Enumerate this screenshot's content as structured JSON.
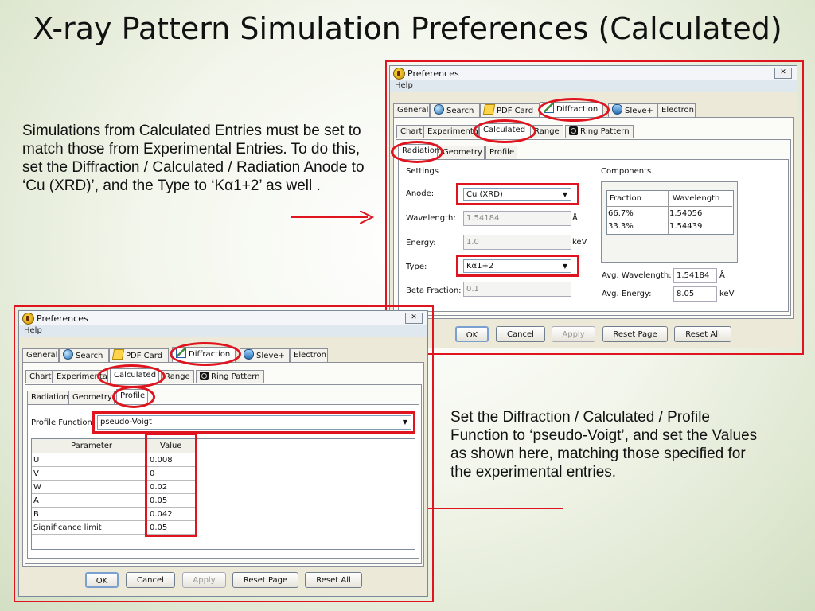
{
  "slide": {
    "title": "X-ray Pattern Simulation Preferences (Calculated)",
    "caption_left": "Simulations from Calculated Entries must be set to match those from Experimental Entries.  To do this, set the Diffraction / Calculated / Radiation  Anode to ‘Cu (XRD)’, and the Type to ‘Kα1+2’ as well .",
    "caption_right": "Set the Diffraction / Calculated / Profile Function to ‘pseudo-Voigt’, and set the Values as shown here, matching those specified for the experimental entries."
  },
  "window": {
    "title": "Preferences",
    "menu": "Help",
    "close": "✕",
    "main_tabs": [
      "General",
      "Search",
      "PDF Card",
      "Diffraction",
      "SIeve+",
      "Electron"
    ],
    "sub_tabs": [
      "Chart",
      "Experimental",
      "Calculated",
      "Range",
      "Ring Pattern"
    ],
    "calc_tabs": [
      "Radiation",
      "Geometry",
      "Profile"
    ],
    "buttons": {
      "ok": "OK",
      "cancel": "Cancel",
      "apply": "Apply",
      "reset_page": "Reset Page",
      "reset_all": "Reset All"
    }
  },
  "radiation": {
    "settings_label": "Settings",
    "components_label": "Components",
    "anode_label": "Anode:",
    "anode_value": "Cu (XRD)",
    "wavelength_label": "Wavelength:",
    "wavelength_value": "1.54184",
    "wavelength_unit": "Å",
    "energy_label": "Energy:",
    "energy_value": "1.0",
    "energy_unit": "keV",
    "type_label": "Type:",
    "type_value": "Kα1+2",
    "beta_label": "Beta Fraction:",
    "beta_value": "0.1",
    "components_headers": [
      "Fraction",
      "Wavelength"
    ],
    "components_rows": [
      [
        "66.7%",
        "1.54056"
      ],
      [
        "33.3%",
        "1.54439"
      ]
    ],
    "avg_wavelength_label": "Avg. Wavelength:",
    "avg_wavelength_value": "1.54184",
    "avg_wavelength_unit": "Å",
    "avg_energy_label": "Avg. Energy:",
    "avg_energy_value": "8.05",
    "avg_energy_unit": "keV"
  },
  "profile": {
    "function_label": "Profile Function:",
    "function_value": "pseudo-Voigt",
    "headers": [
      "Parameter",
      "Value"
    ],
    "rows": [
      [
        "U",
        "0.008"
      ],
      [
        "V",
        "0"
      ],
      [
        "W",
        "0.02"
      ],
      [
        "A",
        "0.05"
      ],
      [
        "B",
        "0.042"
      ],
      [
        "Significance limit",
        "0.05"
      ]
    ]
  },
  "colors": {
    "highlight": "#e0141e",
    "window_bg": "#ece9d8",
    "menu_bg": "#dfe7ef"
  }
}
